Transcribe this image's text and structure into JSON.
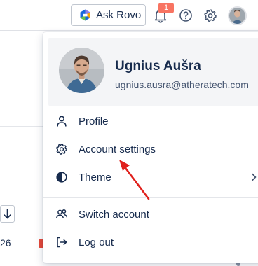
{
  "topbar": {
    "ask_rovo_label": "Ask Rovo",
    "notification_count": "1",
    "icons": [
      "rovo-logo-icon",
      "bell-icon",
      "help-icon",
      "gear-icon",
      "avatar"
    ]
  },
  "background": {
    "row_number_fragment": "26",
    "sort_icon": "arrow-down-icon"
  },
  "profile": {
    "name": "Ugnius Aušra",
    "email": "ugnius.ausra@atheratech.com"
  },
  "menu": {
    "items": [
      {
        "label": "Profile",
        "icon": "person-icon"
      },
      {
        "label": "Account settings",
        "icon": "gear-icon"
      },
      {
        "label": "Theme",
        "icon": "contrast-icon",
        "has_submenu": true
      },
      {
        "label": "Switch account",
        "icon": "people-icon"
      },
      {
        "label": "Log out",
        "icon": "logout-icon"
      }
    ]
  },
  "colors": {
    "annotation_arrow": "#e0201c",
    "notification_badge": "#f87462",
    "profile_card_bg": "#f4f5f7"
  }
}
